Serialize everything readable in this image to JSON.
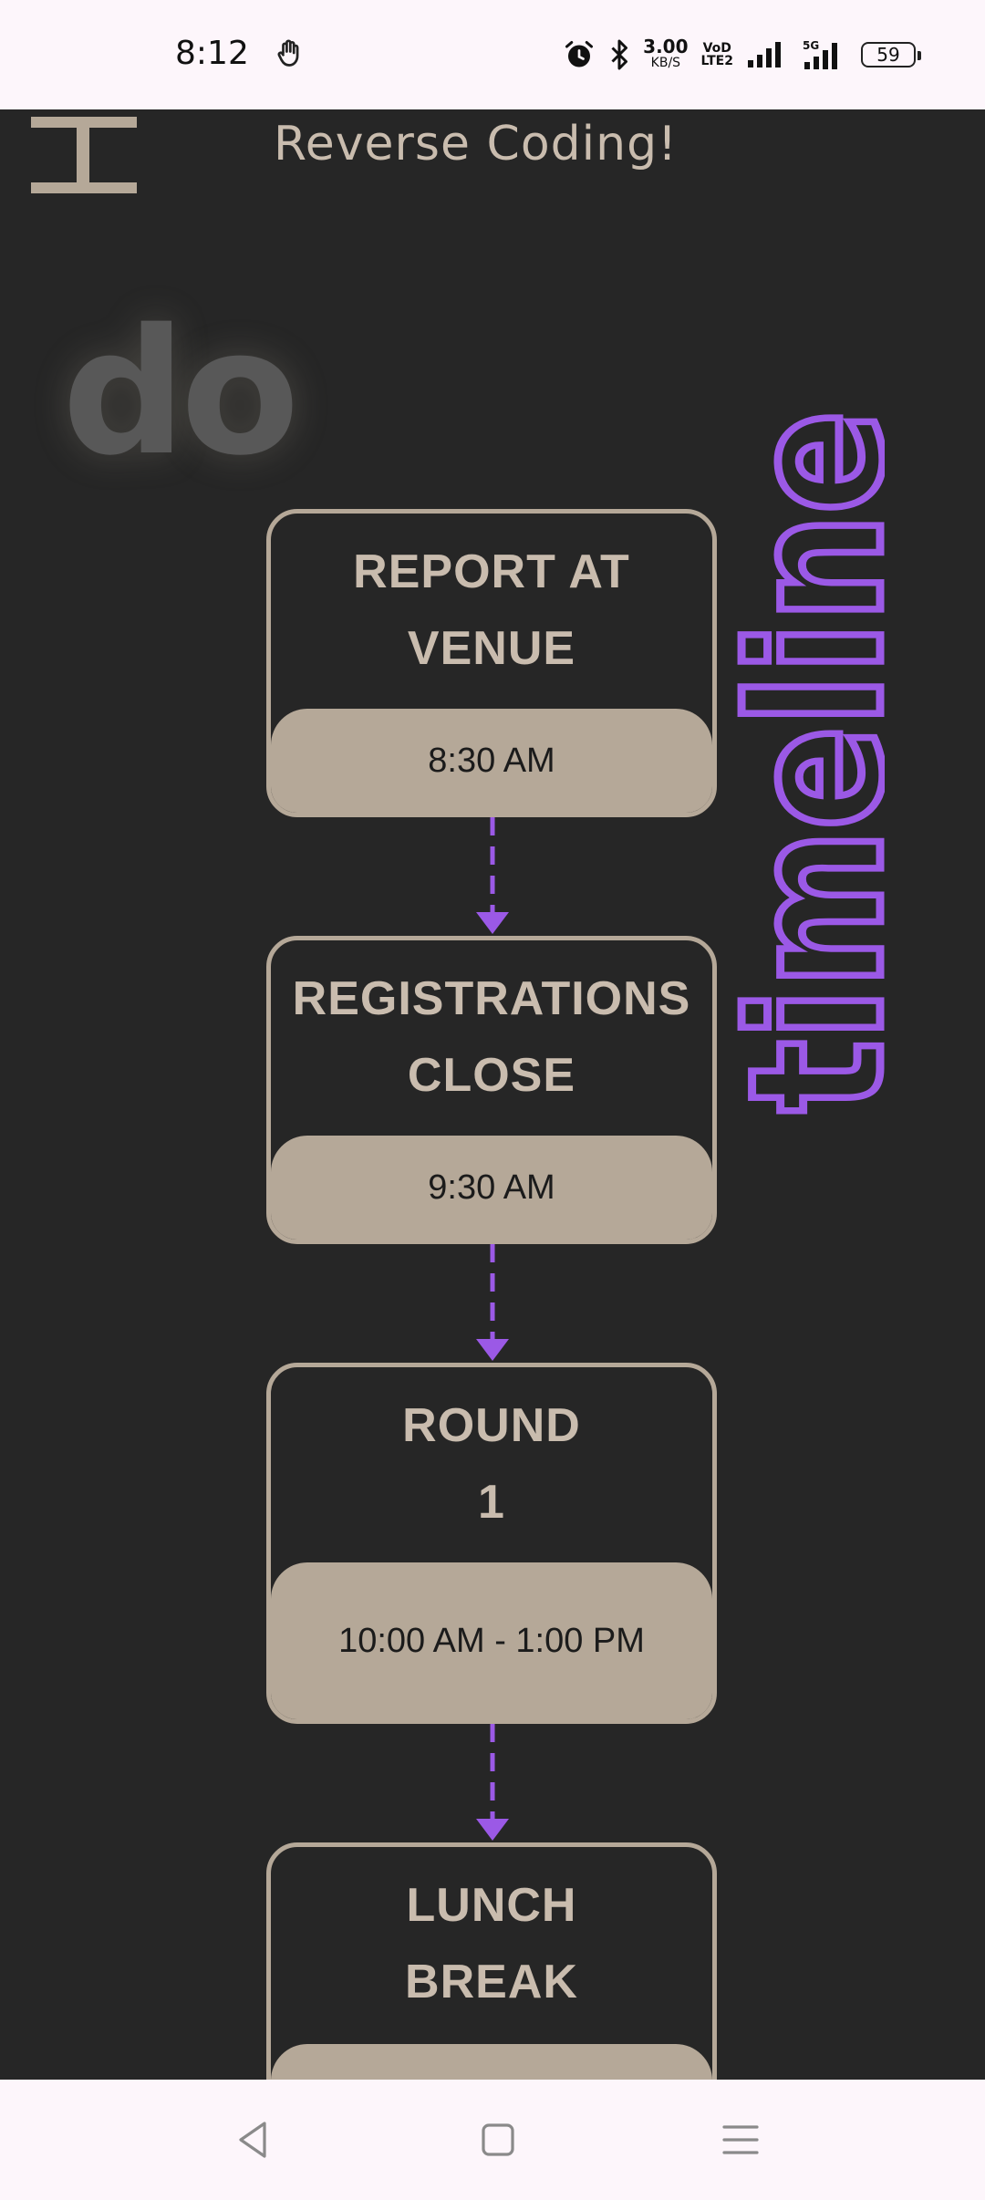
{
  "status_bar": {
    "time": "8:12",
    "speed_value": "3.00",
    "speed_unit": "KB/S",
    "volte_top": "VoD",
    "volte_bottom": "LTE2",
    "network": "5G",
    "battery": "59"
  },
  "header": {
    "site_title": "Reverse Coding!"
  },
  "hero": {
    "ghost_text": "do",
    "vertical_word": "timeline",
    "accent_color": "#9b59e6"
  },
  "timeline": [
    {
      "title_line1": "REPORT AT",
      "title_line2": "VENUE",
      "time": "8:30 AM"
    },
    {
      "title_line1": "REGISTRATIONS",
      "title_line2": "CLOSE",
      "time": "9:30 AM"
    },
    {
      "title_line1": "ROUND",
      "title_line2": "1",
      "time": "10:00 AM - 1:00 PM"
    },
    {
      "title_line1": "LUNCH",
      "title_line2": "BREAK",
      "time": ""
    }
  ],
  "nav": {
    "back_icon": "triangle-back-icon",
    "home_icon": "square-home-icon",
    "menu_icon": "hamburger-menu-icon"
  }
}
